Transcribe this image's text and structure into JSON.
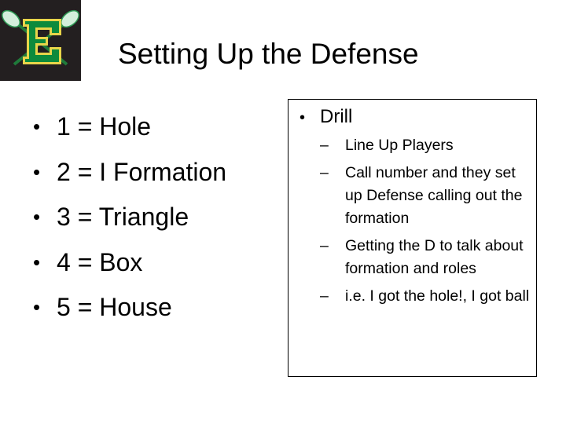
{
  "logo": {
    "letter": "E",
    "colors": {
      "background": "#231f20",
      "green": "#0d8a3c",
      "gold": "#e8d54a",
      "stick_head": "#c8e8d0"
    }
  },
  "title": "Setting Up the Defense",
  "formations": [
    {
      "bullet": "•",
      "text": "1 = Hole"
    },
    {
      "bullet": "•",
      "text": "2 = I Formation"
    },
    {
      "bullet": "•",
      "text": "3 = Triangle"
    },
    {
      "bullet": "•",
      "text": "4 = Box"
    },
    {
      "bullet": "•",
      "text": "5 = House"
    }
  ],
  "drill": {
    "bullet": "•",
    "heading": "Drill",
    "items": [
      {
        "dash": "–",
        "text": "Line Up Players"
      },
      {
        "dash": "–",
        "text": "Call number and they set up Defense calling out the formation"
      },
      {
        "dash": "–",
        "text": "Getting the D to talk about formation and roles"
      },
      {
        "dash": "–",
        "text": "i.e. I got the hole!, I got ball"
      }
    ]
  }
}
